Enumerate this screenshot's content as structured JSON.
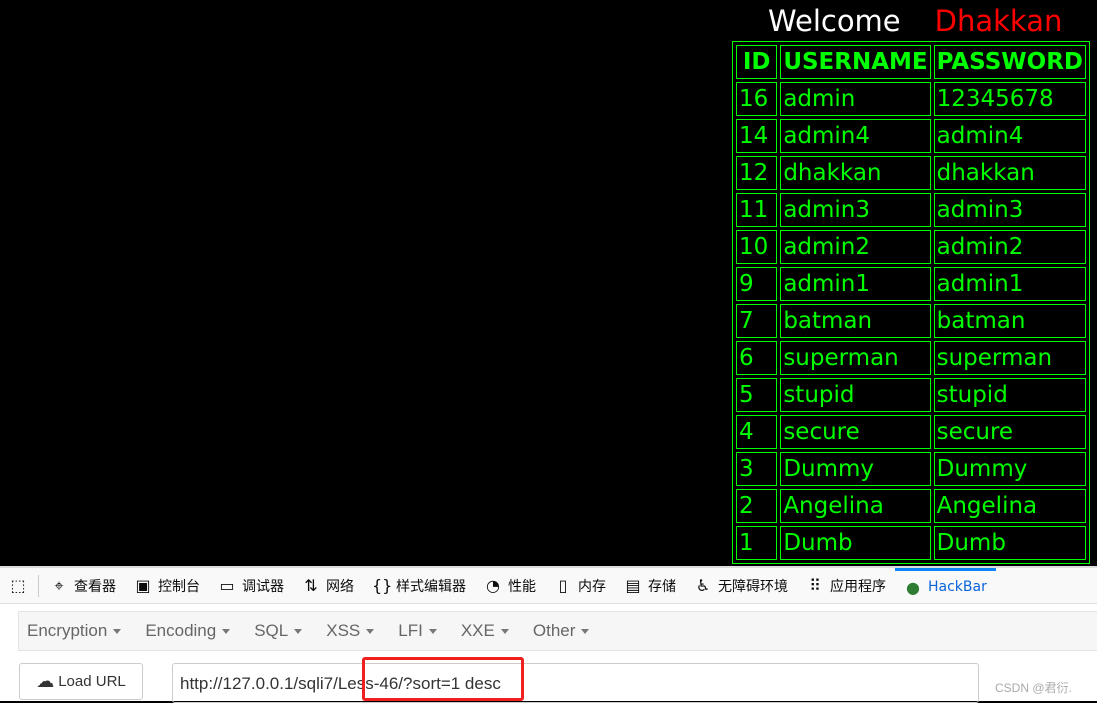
{
  "page": {
    "welcome": "Welcome",
    "user": "Dhakkan",
    "table": {
      "headers": [
        "ID",
        "USERNAME",
        "PASSWORD"
      ],
      "rows": [
        [
          "16",
          "admin",
          "12345678"
        ],
        [
          "14",
          "admin4",
          "admin4"
        ],
        [
          "12",
          "dhakkan",
          "dhakkan"
        ],
        [
          "11",
          "admin3",
          "admin3"
        ],
        [
          "10",
          "admin2",
          "admin2"
        ],
        [
          "9",
          "admin1",
          "admin1"
        ],
        [
          "7",
          "batman",
          "batman"
        ],
        [
          "6",
          "superman",
          "superman"
        ],
        [
          "5",
          "stupid",
          "stupid"
        ],
        [
          "4",
          "secure",
          "secure"
        ],
        [
          "3",
          "Dummy",
          "Dummy"
        ],
        [
          "2",
          "Angelina",
          "Angelina"
        ],
        [
          "1",
          "Dumb",
          "Dumb"
        ]
      ]
    }
  },
  "devtools": {
    "tabs": [
      {
        "label": "查看器",
        "icon": "inspector-icon"
      },
      {
        "label": "控制台",
        "icon": "console-icon"
      },
      {
        "label": "调试器",
        "icon": "debugger-icon"
      },
      {
        "label": "网络",
        "icon": "network-icon"
      },
      {
        "label": "样式编辑器",
        "icon": "style-editor-icon"
      },
      {
        "label": "性能",
        "icon": "performance-icon"
      },
      {
        "label": "内存",
        "icon": "memory-icon"
      },
      {
        "label": "存储",
        "icon": "storage-icon"
      },
      {
        "label": "无障碍环境",
        "icon": "accessibility-icon"
      },
      {
        "label": "应用程序",
        "icon": "application-icon"
      },
      {
        "label": "HackBar",
        "icon": "hackbar-icon",
        "active": true
      }
    ]
  },
  "hackbar": {
    "menus": [
      "Encryption",
      "Encoding",
      "SQL",
      "XSS",
      "LFI",
      "XXE",
      "Other"
    ],
    "load_url": "Load URL",
    "url": "http://127.0.0.1/sqli7/Less-46/?sort=1 desc"
  },
  "watermark": "CSDN @君衍.",
  "colors": {
    "table": "#00ff00",
    "user": "#ff0000",
    "active_tab": "#0a84ff",
    "highlight": "#f02020"
  }
}
